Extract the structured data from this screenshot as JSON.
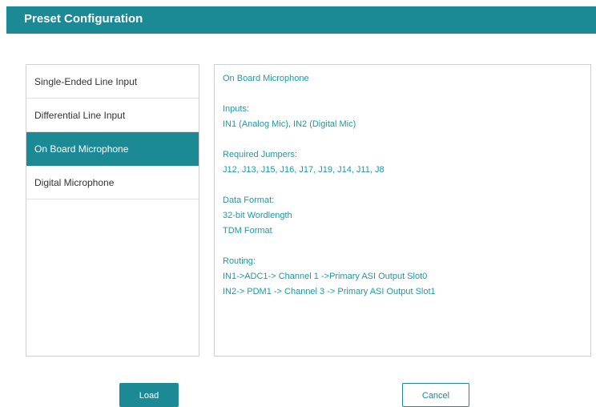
{
  "window": {
    "title": "Preset Configuration"
  },
  "colors": {
    "accent": "#1b8a95",
    "detail_text": "#1b9aa6"
  },
  "presets": {
    "items": [
      {
        "label": "Single-Ended Line Input",
        "selected": false
      },
      {
        "label": "Differential Line Input",
        "selected": false
      },
      {
        "label": "On Board Microphone",
        "selected": true
      },
      {
        "label": "Digital Microphone",
        "selected": false
      }
    ]
  },
  "details": {
    "name": "On Board Microphone",
    "inputs_heading": "Inputs:",
    "inputs_value": "IN1 (Analog Mic), IN2 (Digital Mic)",
    "jumpers_heading": "Required Jumpers:",
    "jumpers_value": "J12, J13, J15, J16, J17, J19, J14, J11, J8",
    "format_heading": "Data Format:",
    "format_wordlength": "32-bit Wordlength",
    "format_tdm": "TDM Format",
    "routing_heading": "Routing:",
    "routing_line1": "IN1->ADC1-> Channel 1 ->Primary ASI Output Slot0",
    "routing_line2": "IN2-> PDM1 -> Channel 3 -> Primary ASI Output Slot1"
  },
  "buttons": {
    "load_label": "Load",
    "cancel_label": "Cancel"
  }
}
